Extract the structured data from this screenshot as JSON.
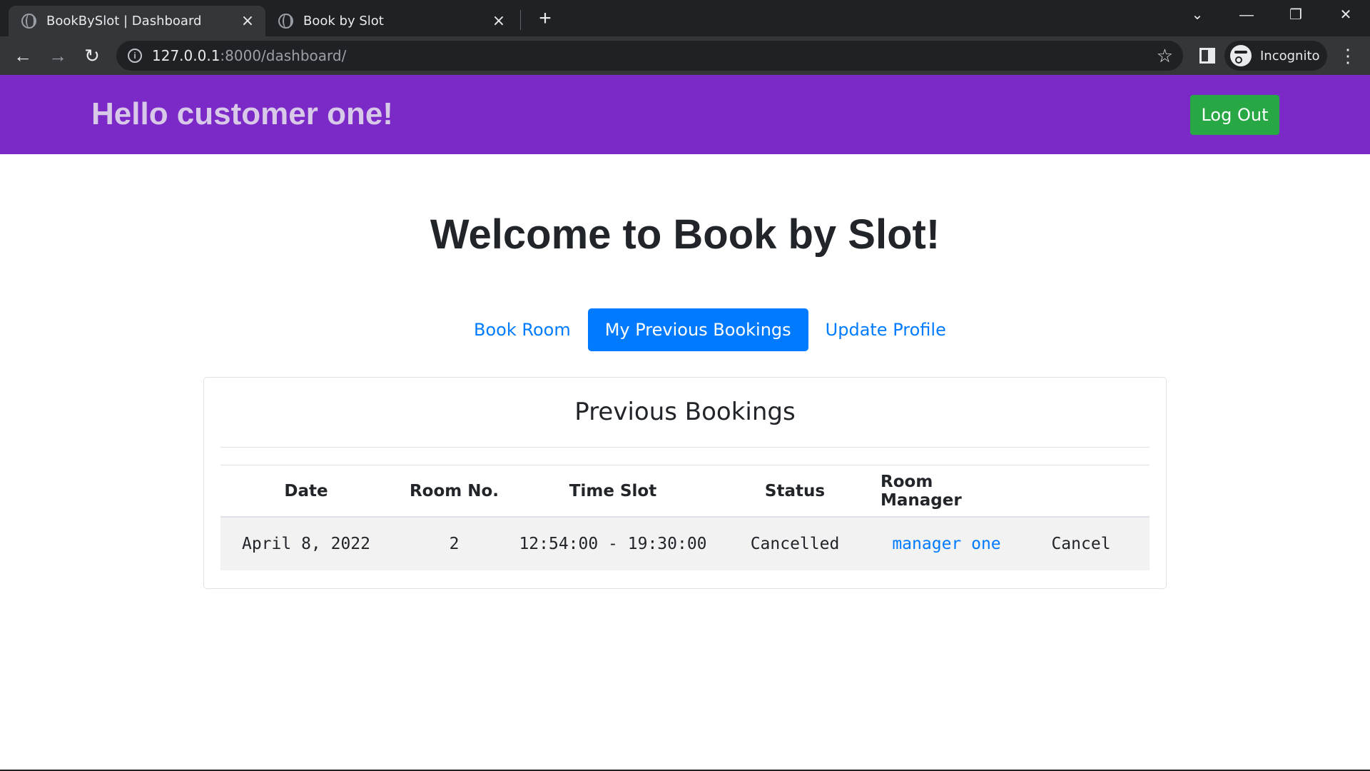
{
  "browser": {
    "tabs": [
      {
        "title": "BookBySlot | Dashboard",
        "active": true
      },
      {
        "title": "Book by Slot",
        "active": false
      }
    ],
    "url_host": "127.0.0.1",
    "url_rest": ":8000/dashboard/",
    "profile_label": "Incognito"
  },
  "header": {
    "greeting": "Hello customer one!",
    "logout_label": "Log Out"
  },
  "main": {
    "welcome": "Welcome to Book by Slot!",
    "tabs": [
      {
        "label": "Book Room",
        "active": false
      },
      {
        "label": "My Previous Bookings",
        "active": true
      },
      {
        "label": "Update Profile",
        "active": false
      }
    ],
    "bookings": {
      "title": "Previous Bookings",
      "columns": [
        "Date",
        "Room No.",
        "Time Slot",
        "Status",
        "Room Manager",
        ""
      ],
      "rows": [
        {
          "date": "April 8, 2022",
          "room_no": "2",
          "time_slot": "12:54:00 - 19:30:00",
          "status": "Cancelled",
          "room_manager": "manager one",
          "action": "Cancel"
        }
      ]
    }
  },
  "colors": {
    "navbar": "#7b2ac7",
    "primary": "#007bff",
    "success": "#28a745"
  }
}
